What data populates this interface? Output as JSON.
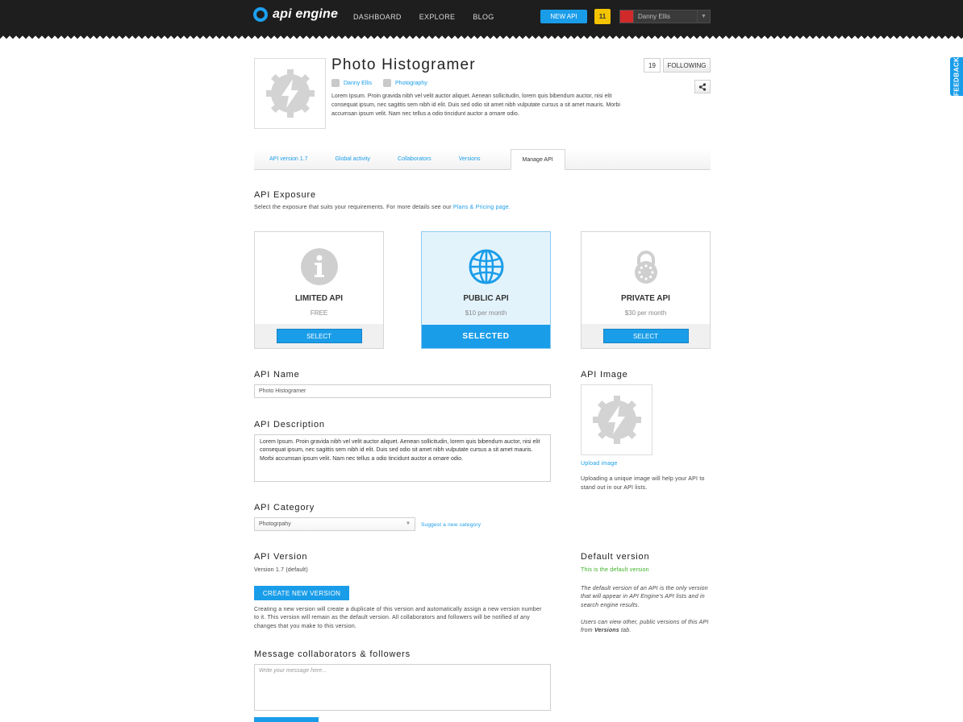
{
  "topbar": {
    "logo_text": "api engine",
    "nav": [
      "DASHBOARD",
      "EXPLORE",
      "BLOG"
    ],
    "new_api_label": "NEW API",
    "notification_count": "11",
    "user_name": "Danny Ellis"
  },
  "feedback_label": "FEEDBACK",
  "api": {
    "title": "Photo Histogramer",
    "author": "Danny Ellis",
    "category": "Photography",
    "description": "Lorem Ipsum. Proin gravida nibh vel velit auctor aliquet. Aenean sollicitudin, lorem quis bibendum auctor, nisi elit consequat ipsum, nec sagittis sem nibh id elit. Duis sed odio sit amet nibh vulputate cursus a sit amet mauris. Morbi accumsan ipsum velit. Nam nec tellus a odio tincidunt auctor a ornare odio.",
    "followers_count": "19",
    "following_label": "FOLLOWING"
  },
  "tabs": [
    "API version 1.7",
    "Global activity",
    "Collaborators",
    "Versions",
    "Manage API"
  ],
  "active_tab": "Manage API",
  "exposure": {
    "title": "API Exposure",
    "subtitle": "Select the exposure that suits your requirements. For more details see our",
    "subtitle_link": "Plans & Pricing page.",
    "plans": [
      {
        "name": "LIMITED API",
        "price": "FREE",
        "button": "SELECT",
        "icon": "info-icon"
      },
      {
        "name": "PUBLIC API",
        "price": "$10 per month",
        "button": "SELECTED",
        "icon": "globe-icon"
      },
      {
        "name": "PRIVATE API",
        "price": "$30 per month",
        "button": "SELECT",
        "icon": "lock-icon"
      }
    ],
    "accent_color": "#1a9de9"
  },
  "form": {
    "name_label": "API Name",
    "name_value": "Photo Histogramer",
    "description_label": "API Description",
    "description_value": "Lorem Ipsum. Proin gravida nibh vel velit auctor aliquet. Aenean sollicitudin, lorem quis bibendum auctor, nisi elit consequat ipsum, nec sagittis sem nibh id elit. Duis sed odio sit amet nibh vulputate cursus a sit amet mauris. Morbi accumsan ipsum velit. Nam nec tellus a odio tincidunt auctor a ornare odio.",
    "category_label": "API Category",
    "category_value": "Photogrpahy",
    "suggest_link": "Suggest a new category",
    "image_label": "API Image",
    "upload_link": "Upload image",
    "image_help": "Uploading a unique image will help your API to stand out in our API lists.",
    "version_label": "API Version",
    "version_value": "Version 1.7 (default)",
    "create_version_button": "CREATE NEW  VERSION",
    "version_help": "Creating a new version will create a duplicate of this version and automatically assign a new version number to it. This version will remain as the default version. All collaborators and followers will be notified of any changes that you make to this version.",
    "default_version_title": "Default version",
    "default_version_status": "This is the default version",
    "default_help_1": "The default version of an API is the only version that will appear in API Engine's API lists and in search engine results.",
    "default_help_2a": "Users can view other, public versions of this API from ",
    "default_help_2b": "Versions",
    "default_help_2c": " tab.",
    "message_label": "Message collaborators & followers",
    "message_placeholder": "Write your message here..."
  }
}
